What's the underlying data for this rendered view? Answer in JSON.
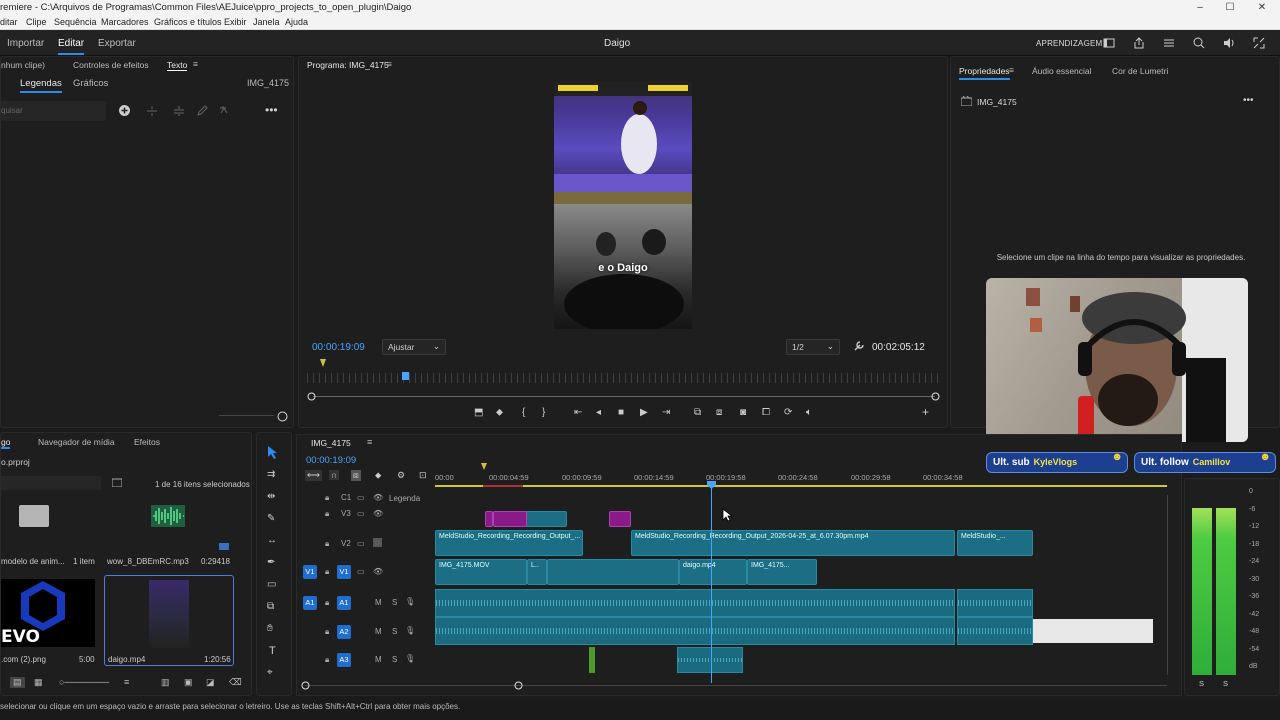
{
  "window": {
    "title": "remiere - C:\\Arquivos de Programas\\Common Files\\AEJuice\\ppro_projects_to_open_plugin\\Daigo",
    "controls": [
      "–",
      "☐",
      "✕"
    ]
  },
  "menu": [
    "ditar",
    "Clipe",
    "Sequência",
    "Marcadores",
    "Gráficos e títulos",
    "Exibir",
    "Janela",
    "Ajuda"
  ],
  "workspace": {
    "tabs": [
      {
        "label": "Importar",
        "active": false
      },
      {
        "label": "Editar",
        "active": true
      },
      {
        "label": "Exportar",
        "active": false
      }
    ],
    "project_name": "Daigo",
    "learn_label": "APRENDIZAGEM"
  },
  "left_panel": {
    "tabs": [
      "nhum clipe)",
      "Controles de efeitos",
      "Texto"
    ],
    "subtabs": [
      {
        "label": "Legendas",
        "active": true
      },
      {
        "label": "Gráficos",
        "active": false
      }
    ],
    "clip_name": "IMG_4175",
    "search_placeholder": "quisar"
  },
  "program_monitor": {
    "title": "Programa: IMG_4175",
    "caption": "e o Daigo",
    "current_time": "00:00:19:09",
    "fit_label": "Ajustar",
    "resolution": "1/2",
    "duration": "00:02:05:12",
    "playhead_fraction": 0.15
  },
  "properties_panel": {
    "tabs": [
      {
        "label": "Propriedades",
        "active": true
      },
      {
        "label": "Áudio essencial",
        "active": false
      },
      {
        "label": "Cor de Lumetri",
        "active": false
      }
    ],
    "clip_name": "IMG_4175",
    "hint": "Selecione um clipe na linha do tempo para visualizar as propriedades."
  },
  "project_panel": {
    "tabs": [
      "go",
      "Navegador de mídia",
      "Efeitos"
    ],
    "project_file": "o.prproj",
    "selection_info": "1 de 16 itens selecionados",
    "items": [
      {
        "name": "modelo de anim...",
        "meta": "1 item",
        "kind": "folder"
      },
      {
        "name": "wow_8_DBEmRC.mp3",
        "meta": "0:29418",
        "kind": "audio"
      },
      {
        "name": ".com (2).png",
        "meta": "5:00",
        "kind": "image",
        "logo_text": "EVO"
      },
      {
        "name": "daigo.mp4",
        "meta": "1:20:56",
        "kind": "video"
      }
    ]
  },
  "timeline": {
    "sequence": "IMG_4175",
    "current_time": "00:00:19:09",
    "ruler": [
      "00:00",
      "00:00:04:59",
      "00:00:09:59",
      "00:00:14:59",
      "00:00:19:58",
      "00:00:24:58",
      "00:00:29:58",
      "00:00:34:58"
    ],
    "tracks": [
      {
        "id": "C1",
        "label": "Legenda"
      },
      {
        "id": "V3",
        "label": ""
      },
      {
        "id": "V2",
        "label": ""
      },
      {
        "id": "V1",
        "label": "",
        "source": "V1"
      },
      {
        "id": "A1",
        "label": "",
        "source": "A1",
        "buttons": [
          "M",
          "S"
        ]
      },
      {
        "id": "A2",
        "label": "",
        "buttons": [
          "M",
          "S"
        ]
      },
      {
        "id": "A3",
        "label": "",
        "buttons": [
          "M",
          "S"
        ]
      }
    ],
    "clips_v2": [
      "MeldStudio_Recording_Recording_Output_...",
      "MeldStudio_Recording_Recording_Output_2026-04-25_at_6.07.30pm.mp4",
      "MeldStudio_..."
    ],
    "clips_v1": [
      "IMG_4175.MOV",
      "L..",
      "daigo.mp4",
      "IMG_4175..."
    ]
  },
  "meter": {
    "scale": [
      "0",
      "-6",
      "-12",
      "-18",
      "-24",
      "-30",
      "-36",
      "-42",
      "-48",
      "-54",
      "dB"
    ],
    "channels": [
      "S",
      "S"
    ],
    "level_left": 0.88,
    "level_right": 0.88
  },
  "overlay": {
    "sub_label": "Ult. sub",
    "sub_name": "KyleVlogs",
    "follow_label": "Ult. follow",
    "follow_name": "Camillov"
  },
  "status": "selecionar ou clique em um espaço vazio e arraste para selecionar o letreiro. Use as teclas Shift+Alt+Ctrl para obter mais opções.",
  "colors": {
    "accent": "#2d8ceb",
    "timecode": "#4aa3ff",
    "clip": "#1c6e84",
    "badge": "#1d3f8f"
  }
}
